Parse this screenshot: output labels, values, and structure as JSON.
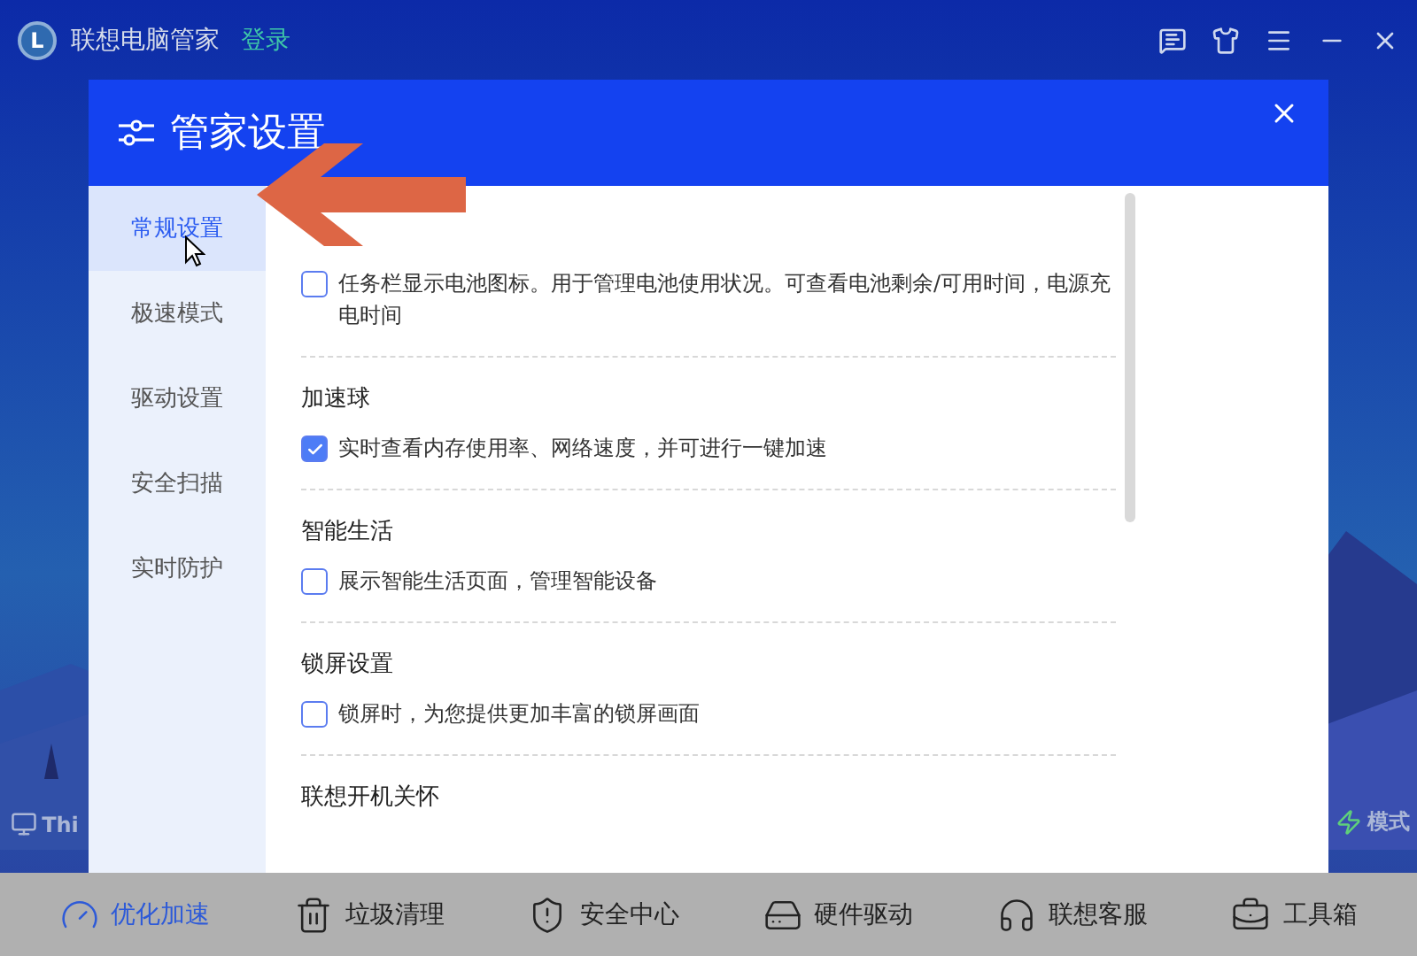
{
  "app": {
    "logo_letter": "L",
    "title": "联想电脑管家",
    "login": "登录"
  },
  "device_label": "Thi",
  "mode_label": "模式",
  "dialog": {
    "title": "管家设置",
    "sidebar": [
      {
        "label": "常规设置",
        "selected": true
      },
      {
        "label": "极速模式",
        "selected": false
      },
      {
        "label": "驱动设置",
        "selected": false
      },
      {
        "label": "安全扫描",
        "selected": false
      },
      {
        "label": "实时防护",
        "selected": false
      }
    ],
    "sections": [
      {
        "option": "任务栏显示电池图标。用于管理电池使用状况。可查看电池剩余/可用时间，电源充电时间",
        "checked": false
      },
      {
        "title": "加速球",
        "option": "实时查看内存使用率、网络速度，并可进行一键加速",
        "checked": true
      },
      {
        "title": "智能生活",
        "option": "展示智能生活页面，管理智能设备",
        "checked": false
      },
      {
        "title": "锁屏设置",
        "option": "锁屏时，为您提供更加丰富的锁屏画面",
        "checked": false
      },
      {
        "title": "联想开机关怀"
      }
    ]
  },
  "nav": [
    {
      "label": "优化加速",
      "selected": true
    },
    {
      "label": "垃圾清理",
      "selected": false
    },
    {
      "label": "安全中心",
      "selected": false
    },
    {
      "label": "硬件驱动",
      "selected": false
    },
    {
      "label": "联想客服",
      "selected": false
    },
    {
      "label": "工具箱",
      "selected": false
    }
  ]
}
